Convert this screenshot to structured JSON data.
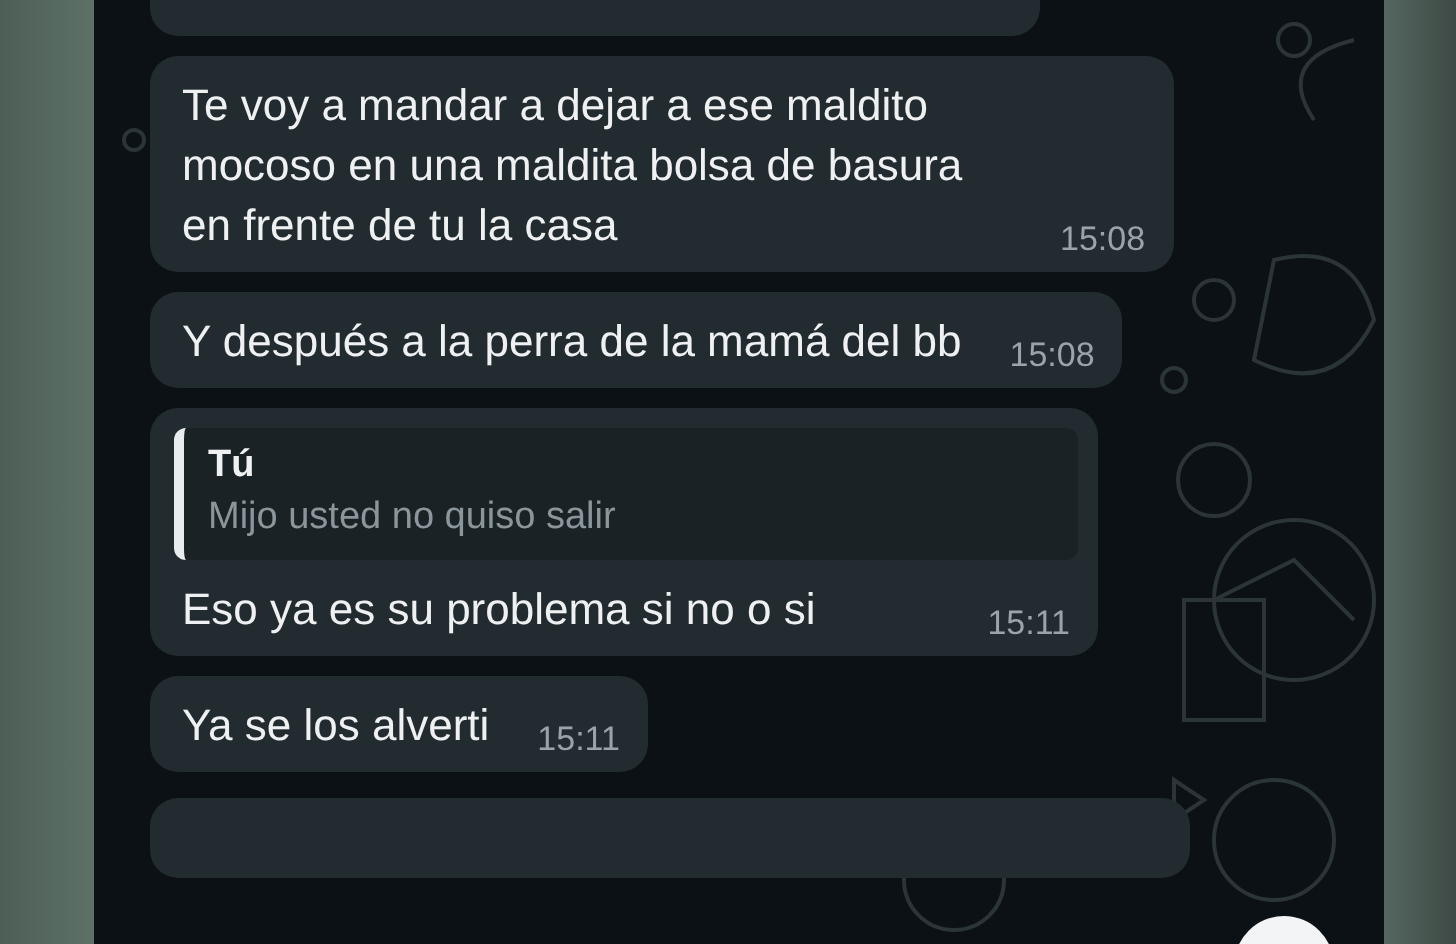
{
  "messages": [
    {
      "kind": "cut-top"
    },
    {
      "kind": "text",
      "text": "Te voy a mandar a dejar a ese maldito mocoso en una maldita bolsa de basura en frente de tu la casa",
      "time": "15:08"
    },
    {
      "kind": "text",
      "text": "Y después a la perra de la mamá del bb",
      "time": "15:08"
    },
    {
      "kind": "reply",
      "quote_author": "Tú",
      "quote_text": "Mijo usted no quiso salir",
      "text": "Eso ya es su problema si no o si",
      "time": "15:11"
    },
    {
      "kind": "text",
      "text": "Ya se los alverti",
      "time": "15:11"
    },
    {
      "kind": "cut-bottom"
    }
  ]
}
